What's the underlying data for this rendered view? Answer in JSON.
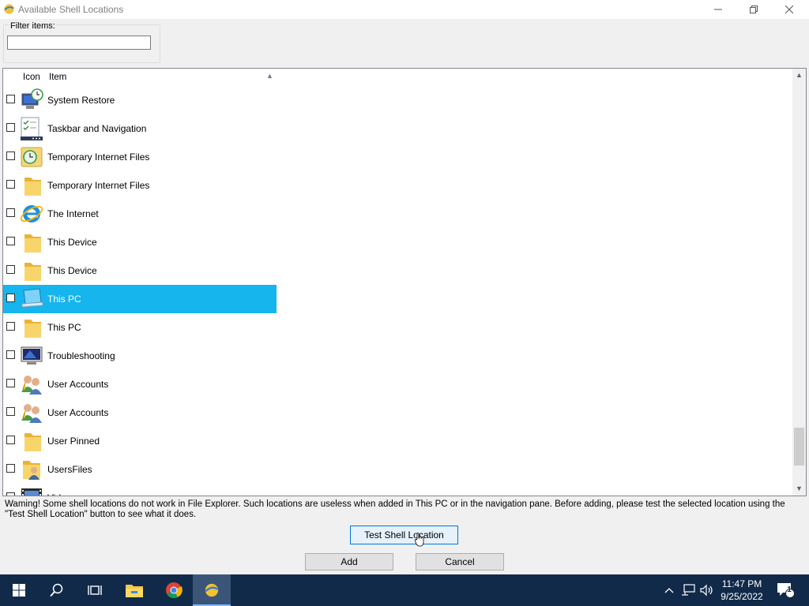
{
  "window": {
    "title": "Available Shell Locations"
  },
  "filter": {
    "label": "Filter items:",
    "value": "",
    "placeholder": ""
  },
  "list": {
    "columns": [
      "Icon",
      "Item"
    ],
    "rows": [
      {
        "label": "System Restore",
        "icon": "system-restore-icon",
        "checked": false,
        "selected": false
      },
      {
        "label": "Taskbar and Navigation",
        "icon": "taskbar-navigation-icon",
        "checked": false,
        "selected": false
      },
      {
        "label": "Temporary Internet Files",
        "icon": "temp-internet-files-icon",
        "checked": false,
        "selected": false
      },
      {
        "label": "Temporary Internet Files",
        "icon": "folder-icon",
        "checked": false,
        "selected": false
      },
      {
        "label": "The Internet",
        "icon": "internet-explorer-icon",
        "checked": false,
        "selected": false
      },
      {
        "label": "This Device",
        "icon": "folder-icon",
        "checked": false,
        "selected": false
      },
      {
        "label": "This Device",
        "icon": "folder-icon",
        "checked": false,
        "selected": false
      },
      {
        "label": "This PC",
        "icon": "this-pc-icon",
        "checked": false,
        "selected": true
      },
      {
        "label": "This PC",
        "icon": "folder-icon",
        "checked": false,
        "selected": false
      },
      {
        "label": "Troubleshooting",
        "icon": "troubleshooting-icon",
        "checked": false,
        "selected": false
      },
      {
        "label": "User Accounts",
        "icon": "user-accounts-icon",
        "checked": false,
        "selected": false
      },
      {
        "label": "User Accounts",
        "icon": "user-accounts-icon",
        "checked": false,
        "selected": false
      },
      {
        "label": "User Pinned",
        "icon": "folder-icon",
        "checked": false,
        "selected": false
      },
      {
        "label": "UsersFiles",
        "icon": "user-folder-icon",
        "checked": false,
        "selected": false
      },
      {
        "label": "Videos",
        "icon": "videos-icon",
        "checked": false,
        "selected": false
      }
    ]
  },
  "warning": "Waming! Some shell locations do not work in File Explorer. Such locations are useless when added in This PC or in the navigation pane. Before adding, please test the selected location using the \"Test Shell Location\" button to see what it does.",
  "buttons": {
    "test": "Test Shell Location",
    "add": "Add",
    "cancel": "Cancel"
  },
  "taskbar": {
    "time": "11:47 PM",
    "date": "9/25/2022",
    "notification_count": "1"
  },
  "colors": {
    "selection": "#16b5ed",
    "taskbar": "#112a4a",
    "folder": "#f5c84c"
  }
}
